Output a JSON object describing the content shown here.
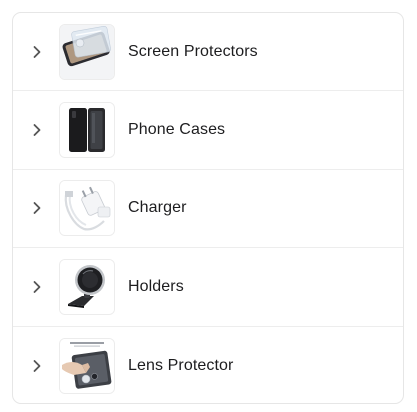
{
  "categories": [
    {
      "label": "Screen Protectors",
      "icon": "screen-protector-image"
    },
    {
      "label": "Phone Cases",
      "icon": "phone-case-image"
    },
    {
      "label": "Charger",
      "icon": "charger-image"
    },
    {
      "label": "Holders",
      "icon": "phone-holder-image"
    },
    {
      "label": "Lens Protector",
      "icon": "lens-protector-image"
    }
  ],
  "colors": {
    "text": "#1d1d1f",
    "chevron": "#555555",
    "border": "#e6e6e6"
  }
}
